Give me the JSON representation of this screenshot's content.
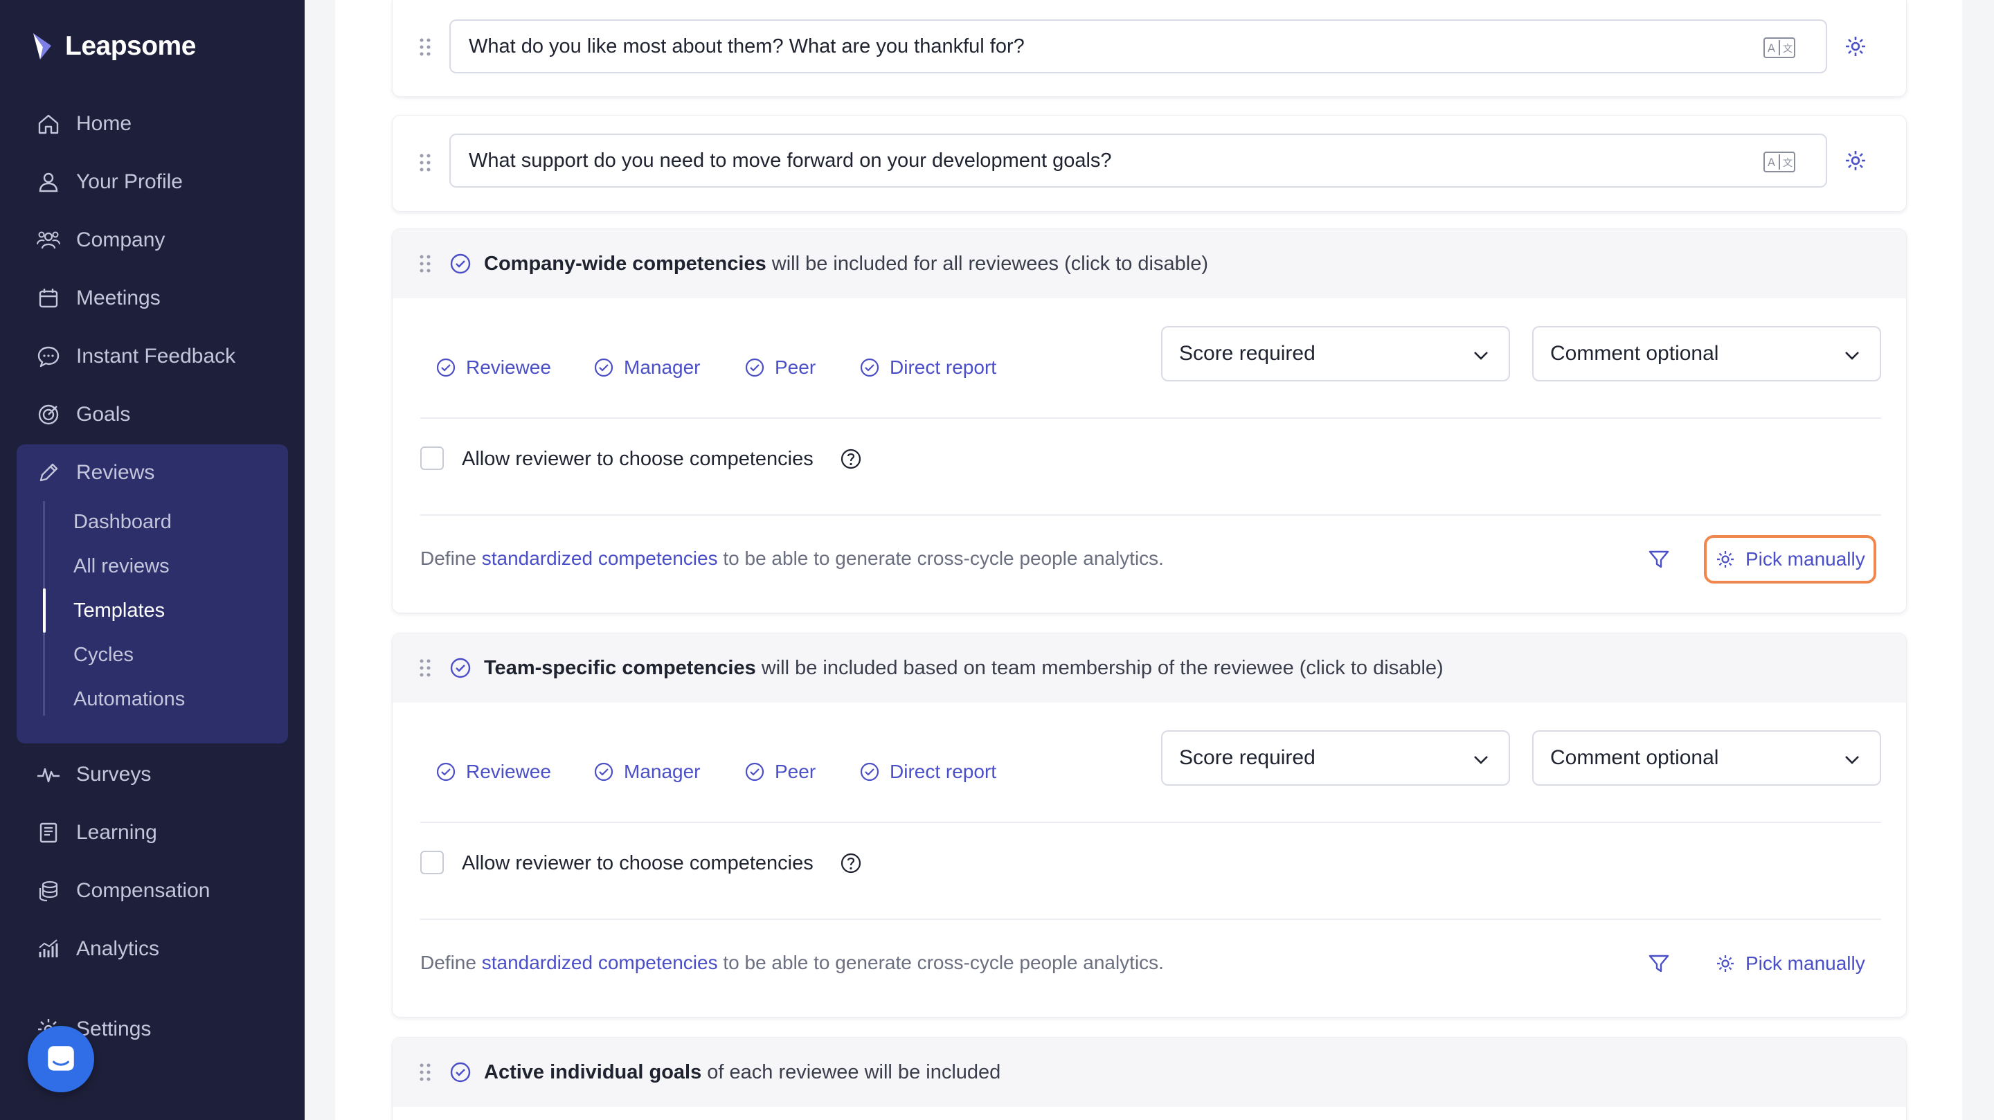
{
  "app": {
    "name": "Leapsome"
  },
  "sidebar": {
    "items": [
      {
        "label": "Home",
        "icon": "home-icon"
      },
      {
        "label": "Your Profile",
        "icon": "user-icon"
      },
      {
        "label": "Company",
        "icon": "people-icon"
      },
      {
        "label": "Meetings",
        "icon": "calendar-icon"
      },
      {
        "label": "Instant Feedback",
        "icon": "chat-bubble-icon"
      },
      {
        "label": "Goals",
        "icon": "target-icon"
      },
      {
        "label": "Reviews",
        "icon": "pencil-icon"
      },
      {
        "label": "Surveys",
        "icon": "pulse-icon"
      },
      {
        "label": "Learning",
        "icon": "book-icon"
      },
      {
        "label": "Compensation",
        "icon": "coins-icon"
      },
      {
        "label": "Analytics",
        "icon": "chart-icon"
      },
      {
        "label": "Settings",
        "icon": "gear-icon"
      }
    ],
    "reviews_sub": [
      {
        "label": "Dashboard"
      },
      {
        "label": "All reviews"
      },
      {
        "label": "Templates",
        "active": true
      },
      {
        "label": "Cycles"
      },
      {
        "label": "Automations"
      }
    ]
  },
  "questions": [
    {
      "text": "What do you like most about them? What are you thankful for?"
    },
    {
      "text": "What support do you need to move forward on your development goals?"
    }
  ],
  "sections": [
    {
      "title_bold": "Company-wide competencies",
      "title_rest": " will be included for all reviewees (click to disable)",
      "roles": [
        "Reviewee",
        "Manager",
        "Peer",
        "Direct report"
      ],
      "score_select": "Score required",
      "comment_select": "Comment optional",
      "allow_label": "Allow reviewer to choose competencies",
      "define_prefix": "Define ",
      "define_link": "standardized competencies",
      "define_suffix": " to be able to generate cross-cycle people analytics.",
      "pick_label": "Pick manually"
    },
    {
      "title_bold": "Team-specific competencies",
      "title_rest": " will be included based on team membership of the reviewee (click to disable)",
      "roles": [
        "Reviewee",
        "Manager",
        "Peer",
        "Direct report"
      ],
      "score_select": "Score required",
      "comment_select": "Comment optional",
      "allow_label": "Allow reviewer to choose competencies",
      "define_prefix": "Define ",
      "define_link": "standardized competencies",
      "define_suffix": " to be able to generate cross-cycle people analytics.",
      "pick_label": "Pick manually"
    },
    {
      "title_bold": "Active individual goals",
      "title_rest": " of each reviewee will be included"
    }
  ],
  "colors": {
    "sidebar": "#1e1f3a",
    "accent": "#4b4fc7",
    "highlight": "#f0874e"
  }
}
